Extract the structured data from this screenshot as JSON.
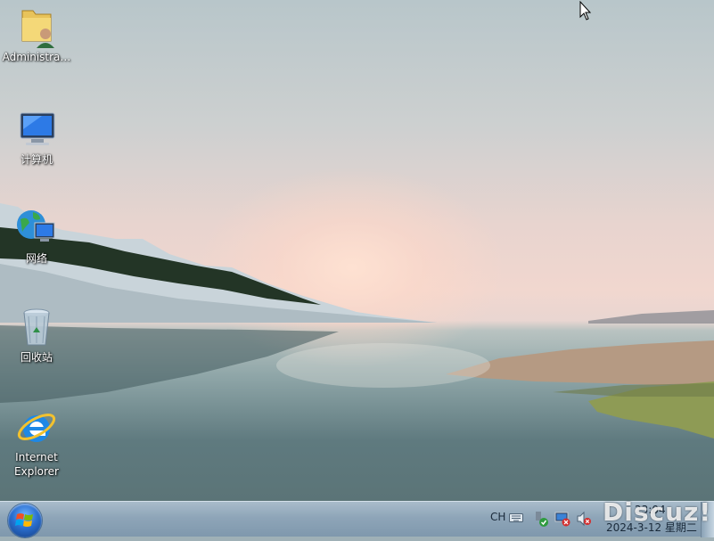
{
  "desktop_icons": [
    {
      "label": "Administra…",
      "icon": "user-folder-icon"
    },
    {
      "label": "计算机",
      "icon": "computer-icon"
    },
    {
      "label": "网络",
      "icon": "network-icon"
    },
    {
      "label": "回收站",
      "icon": "recycle-bin-icon"
    },
    {
      "label": "Internet Explorer",
      "icon": "internet-explorer-icon"
    }
  ],
  "taskbar": {
    "start_button": "windows-start-icon",
    "language": "CH",
    "tray_icons": [
      "keyboard-icon",
      "usb-security-icon",
      "network-disconnected-icon",
      "volume-muted-icon"
    ],
    "clock_time": "23:04",
    "clock_date": "2024-3-12 星期二"
  },
  "watermark": "Discuz!",
  "colors": {
    "taskbar": "#8ea5b8",
    "water": "#5f7a7f",
    "sky_glow": "#f1d7cf"
  }
}
